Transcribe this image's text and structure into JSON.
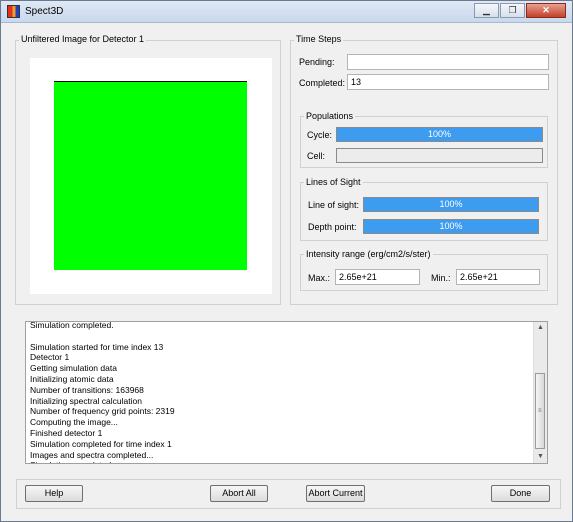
{
  "window": {
    "title": "Spect3D",
    "minimize": "▁",
    "maximize": "❐",
    "close": "✕"
  },
  "image_group": {
    "title": "Unfiltered Image for Detector 1"
  },
  "time_steps": {
    "title": "Time Steps",
    "pending_label": "Pending:",
    "pending_value": "",
    "completed_label": "Completed:",
    "completed_value": "13"
  },
  "populations": {
    "title": "Populations",
    "cycle_label": "Cycle:",
    "cycle_progress": 100,
    "cycle_text": "100%",
    "cell_label": "Cell:",
    "cell_progress": 0
  },
  "lines_of_sight": {
    "title": "Lines of Sight",
    "los_label": "Line of sight:",
    "los_progress": 100,
    "los_text": "100%",
    "depth_label": "Depth point:",
    "depth_progress": 100,
    "depth_text": "100%"
  },
  "intensity": {
    "title": "Intensity range (erg/cm2/s/ster)",
    "max_label": "Max.:",
    "max_value": "2.65e+21",
    "min_label": "Min.:",
    "min_value": "2.65e+21"
  },
  "log": {
    "lines": [
      "Simulation completed.",
      "",
      "Simulation started for time index 13",
      " Detector 1",
      "Getting simulation data",
      "Initializing atomic data",
      "Number of transitions: 163968",
      "Initializing spectral calculation",
      "Number of frequency grid points: 2319",
      "Computing the image...",
      " Finished detector 1",
      "Simulation completed for time index 1",
      "Images and spectra completed...",
      "Simulation completed."
    ]
  },
  "buttons": {
    "help": "Help",
    "abort_all": "Abort All",
    "abort_current": "Abort Current",
    "done": "Done"
  },
  "colors": {
    "progress_fill": "#3d9bf0",
    "image_fill": "#00ff00"
  }
}
